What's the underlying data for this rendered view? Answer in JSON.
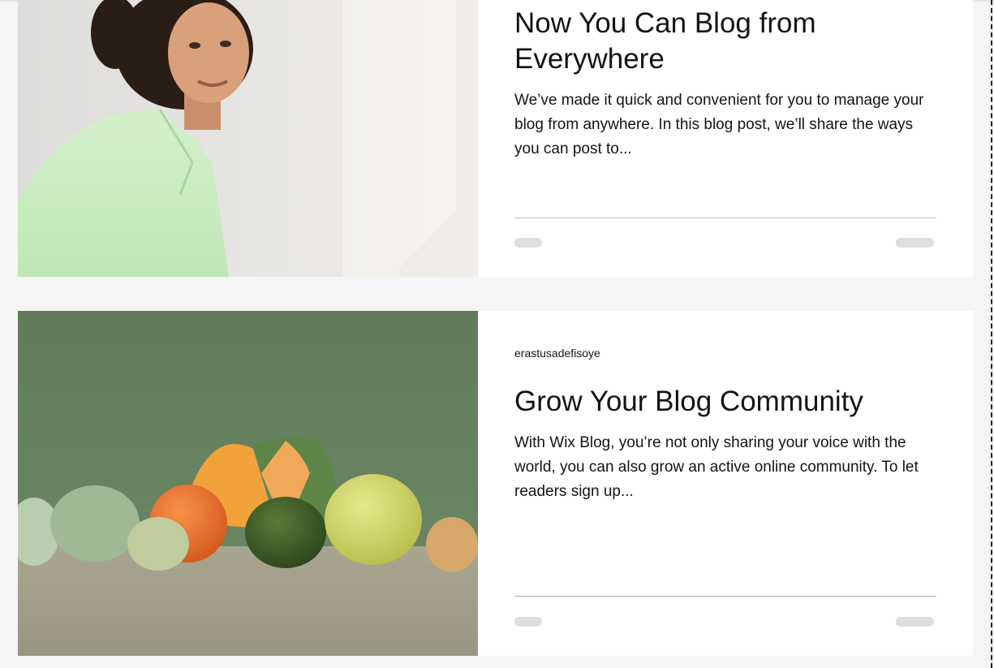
{
  "posts": [
    {
      "image_alt": "Woman in light green shirt smiling",
      "author": "",
      "title": "Now You Can Blog from Everywhere",
      "excerpt": "We’ve made it quick and convenient for you to manage your blog from anywhere. In this blog post, we’ll share the ways you can post to..."
    },
    {
      "image_alt": "Still life of fruits and vegetables on green background",
      "author": "erastusadefisoye",
      "title": "Grow Your Blog Community",
      "excerpt": "With Wix Blog, you’re not only sharing your voice with the world, you can also grow an active online community. To let readers sign up..."
    }
  ],
  "colors": {
    "page_background": "#f5f5f5",
    "card_background": "#ffffff",
    "text": "#151414",
    "skeleton": "#dedede",
    "photo1_shirt": "#c6ebbd",
    "photo2_background": "#66805f"
  }
}
